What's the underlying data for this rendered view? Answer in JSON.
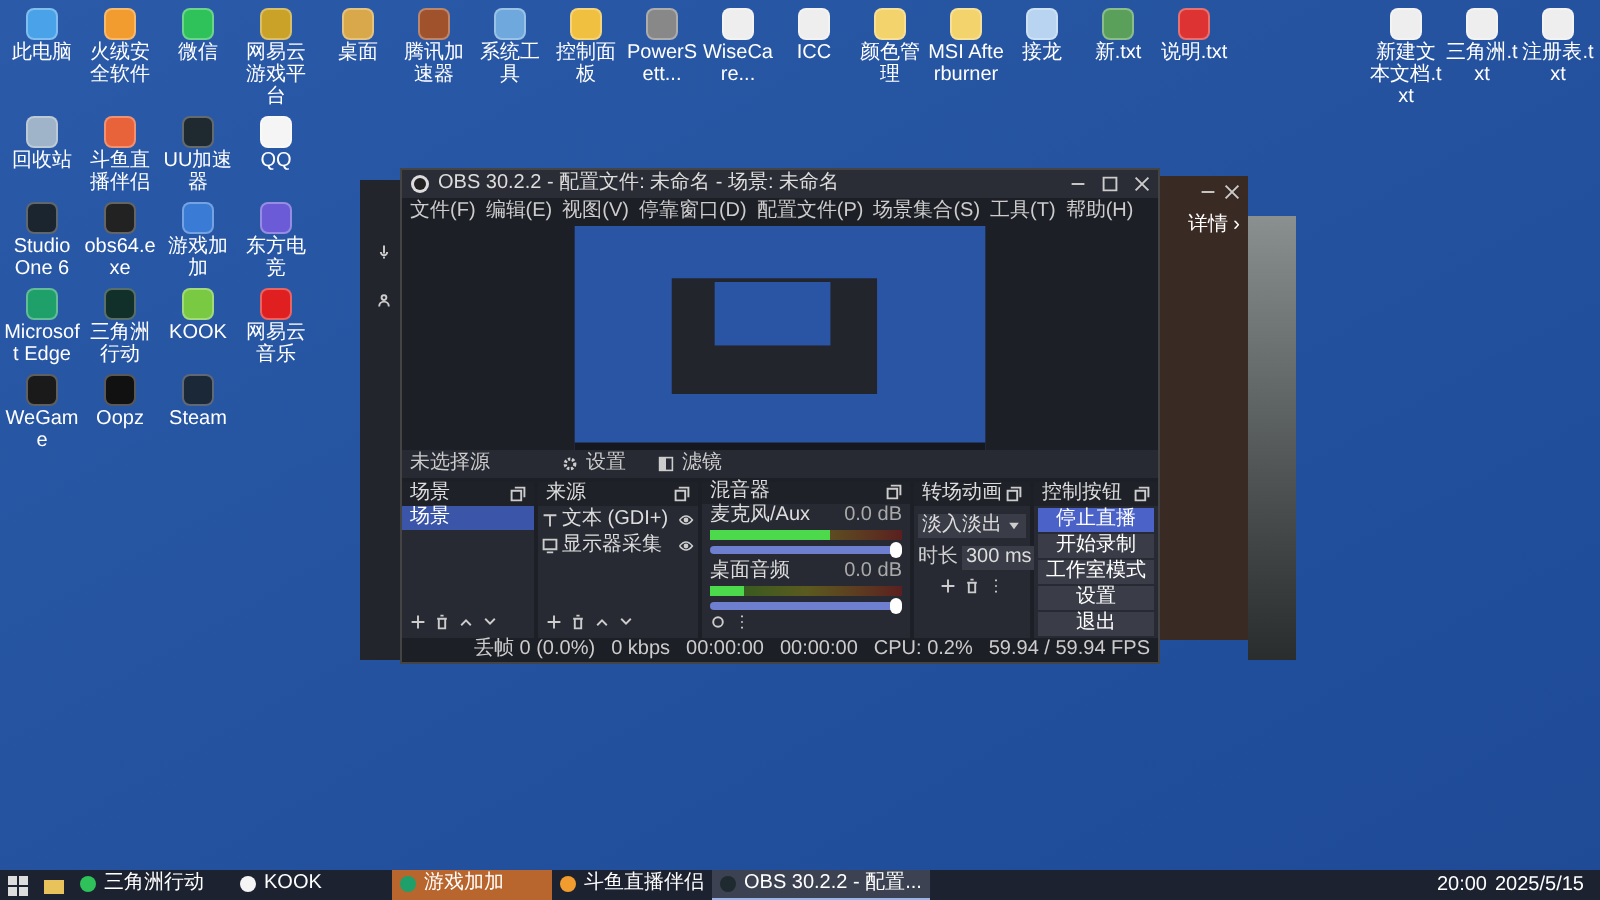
{
  "desktop_icons_left": [
    {
      "label": "此电脑"
    },
    {
      "label": "火绒安全软件"
    },
    {
      "label": "微信"
    },
    {
      "label": "网易云游戏平台"
    },
    {
      "label": "回收站"
    },
    {
      "label": "斗鱼直播伴侣"
    },
    {
      "label": "UU加速器"
    },
    {
      "label": "QQ"
    },
    {
      "label": "Studio One 6"
    },
    {
      "label": "obs64.exe"
    },
    {
      "label": "游戏加加"
    },
    {
      "label": "东方电竞"
    },
    {
      "label": "Microsoft Edge"
    },
    {
      "label": "三角洲行动"
    },
    {
      "label": "KOOK"
    },
    {
      "label": "网易云音乐"
    },
    {
      "label": "WeGame"
    },
    {
      "label": "Oopz"
    },
    {
      "label": "Steam"
    }
  ],
  "desktop_icons_top": [
    {
      "label": "桌面"
    },
    {
      "label": "腾讯加速器"
    },
    {
      "label": "系统工具"
    },
    {
      "label": "控制面板"
    },
    {
      "label": "PowerSett..."
    },
    {
      "label": "WiseCare..."
    },
    {
      "label": "ICC"
    },
    {
      "label": "颜色管理"
    },
    {
      "label": "MSI Afterburner"
    },
    {
      "label": "接龙"
    },
    {
      "label": "新.txt"
    },
    {
      "label": "说明.txt"
    }
  ],
  "desktop_icons_right": [
    {
      "label": "新建文本文档.txt"
    },
    {
      "label": "三角洲.txt"
    },
    {
      "label": "注册表.txt"
    }
  ],
  "side_window": {
    "link": "详情 ›"
  },
  "obs": {
    "title": "OBS 30.2.2 - 配置文件: 未命名 - 场景: 未命名",
    "menu": [
      "文件(F)",
      "编辑(E)",
      "视图(V)",
      "停靠窗口(D)",
      "配置文件(P)",
      "场景集合(S)",
      "工具(T)",
      "帮助(H)"
    ],
    "source_bar": {
      "status": "未选择源",
      "properties": "设置",
      "filters": "滤镜"
    },
    "scenes": {
      "title": "场景",
      "items": [
        {
          "label": "场景",
          "selected": true
        }
      ]
    },
    "sources": {
      "title": "来源",
      "items": [
        {
          "label": "文本 (GDI+)",
          "kind": "text",
          "visible": true
        },
        {
          "label": "显示器采集",
          "kind": "display",
          "visible": true
        }
      ]
    },
    "mixer": {
      "title": "混音器",
      "channels": [
        {
          "name": "麦克风/Aux",
          "reading": "0.0 dB",
          "meter": {
            "level": 0.62
          },
          "volume": {
            "level": 1
          }
        },
        {
          "name": "桌面音频",
          "reading": "0.0 dB",
          "meter": {
            "level": 0.18
          },
          "volume": {
            "level": 1
          }
        }
      ]
    },
    "transitions": {
      "title": "转场动画",
      "transition": "淡入淡出",
      "duration_label": "时长",
      "duration": "300 ms"
    },
    "controls": {
      "title": "控制按钮",
      "buttons": [
        {
          "label": "停止直播",
          "active": true
        },
        {
          "label": "开始录制",
          "active": false
        },
        {
          "label": "工作室模式",
          "active": false
        },
        {
          "label": "设置",
          "active": false
        },
        {
          "label": "退出",
          "active": false
        }
      ]
    },
    "status_bar": {
      "dropped": "丢帧 0 (0.0%)",
      "bitrate": "0 kbps",
      "stream_time": "00:00:00",
      "record_time": "00:00:00",
      "cpu": "CPU: 0.2%",
      "fps": "59.94 / 59.94 FPS"
    }
  },
  "taskbar": {
    "items": [
      {
        "label": "三角洲行动",
        "selected": false,
        "flashing": false
      },
      {
        "label": "KOOK",
        "selected": false,
        "flashing": false
      },
      {
        "label": "游戏加加",
        "selected": false,
        "flashing": true
      },
      {
        "label": "斗鱼直播伴侣",
        "selected": false,
        "flashing": false
      },
      {
        "label": "OBS 30.2.2 - 配置...",
        "selected": true,
        "flashing": false
      }
    ],
    "time": "20:00",
    "date": "2025/5/15"
  }
}
